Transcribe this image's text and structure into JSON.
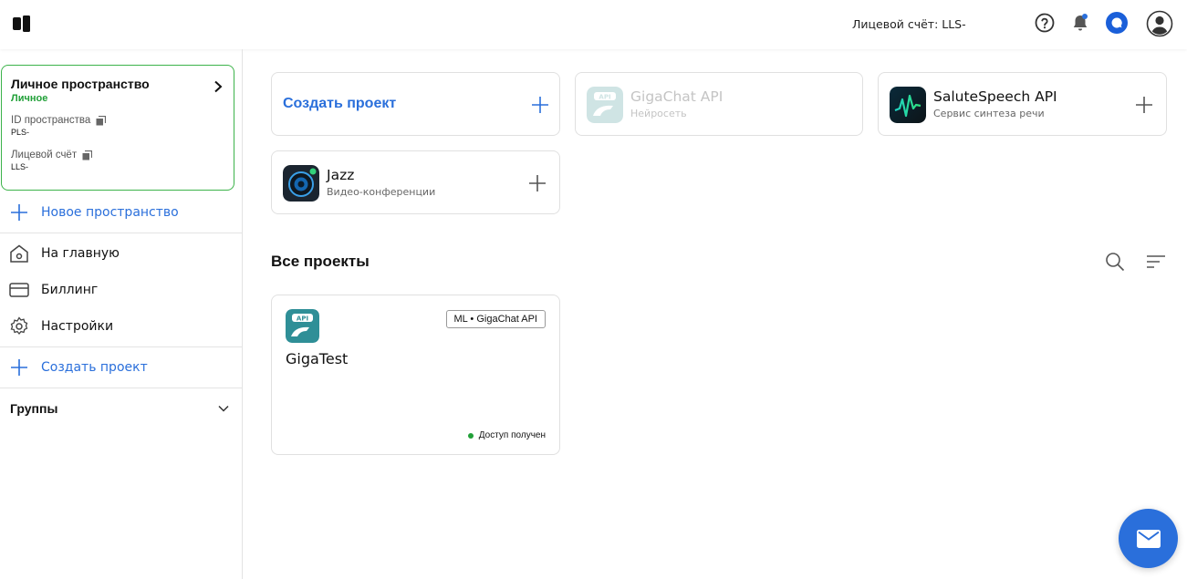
{
  "header": {
    "account_label": "Лицевой счёт: LLS-",
    "icons": [
      "help-icon",
      "bell-icon",
      "app-icon",
      "user-icon"
    ]
  },
  "sidebar": {
    "space": {
      "title": "Личное пространство",
      "type": "Личное",
      "id_label": "ID пространства",
      "id_value": "PLS-",
      "account_label": "Лицевой счёт",
      "account_value": "LLS-"
    },
    "new_space": "Новое пространство",
    "nav": [
      {
        "label": "На главную",
        "icon": "home-icon"
      },
      {
        "label": "Биллинг",
        "icon": "card-icon"
      },
      {
        "label": "Настройки",
        "icon": "gear-icon"
      }
    ],
    "create_project": "Создать проект",
    "groups": "Группы"
  },
  "main": {
    "create_project": "Создать проект",
    "services": [
      {
        "name": "GigaChat API",
        "desc": "Нейросеть",
        "disabled": true
      },
      {
        "name": "SaluteSpeech API",
        "desc": "Сервис синтеза речи"
      },
      {
        "name": "Jazz",
        "desc": "Видео-конференции"
      }
    ],
    "all_projects": "Все проекты",
    "projects": [
      {
        "name": "GigaTest",
        "tag": "ML • GigaChat API",
        "status": "Доступ получен",
        "icon_text": "API"
      }
    ]
  },
  "colors": {
    "accent": "#2a6fdb",
    "green": "#21a038"
  }
}
